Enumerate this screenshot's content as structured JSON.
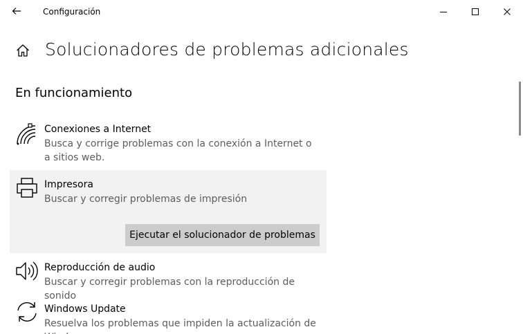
{
  "window": {
    "title": "Configuración"
  },
  "page": {
    "title": "Solucionadores de problemas adicionales",
    "section_title": "En funcionamiento"
  },
  "troubleshooters": [
    {
      "name": "Conexiones a Internet",
      "description": "Busca y corrige problemas con la conexión a Internet o a sitios web.",
      "icon": "wifi-network-icon"
    },
    {
      "name": "Impresora",
      "description": "Buscar y corregir problemas de impresión",
      "icon": "printer-icon",
      "selected": true,
      "action_label": "Ejecutar el solucionador de problemas"
    },
    {
      "name": "Reproducción de audio",
      "description": "Buscar y corregir problemas con la reproducción de sonido",
      "icon": "speaker-icon"
    },
    {
      "name": "Windows Update",
      "description": "Resuelva los problemas que impiden la actualización de Windows.",
      "icon": "sync-icon"
    }
  ],
  "colors": {
    "selected_background": "#f2f2f2",
    "button_background": "#cccccc",
    "secondary_text": "#5d5d5d"
  }
}
